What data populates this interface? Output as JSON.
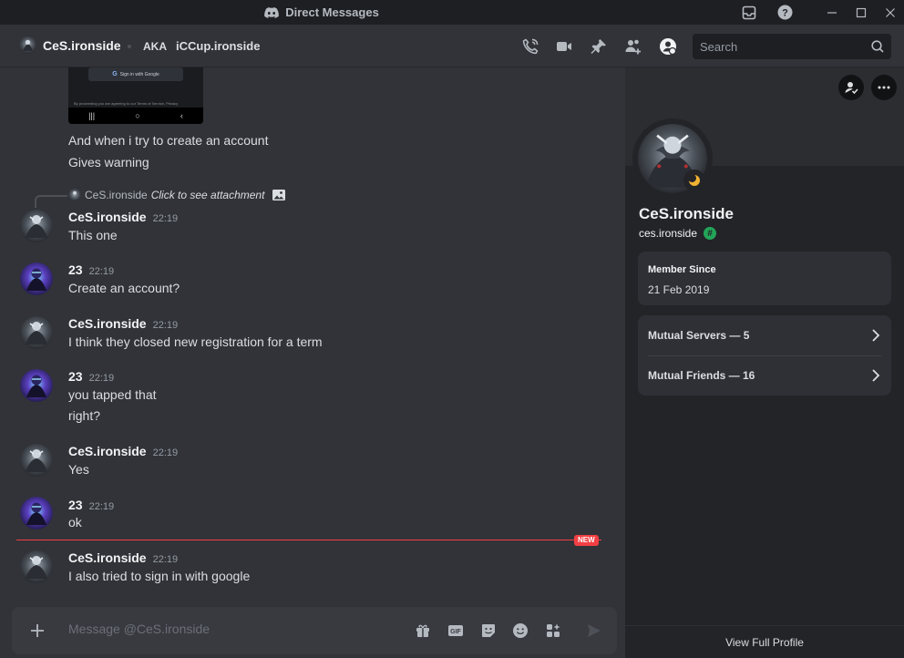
{
  "window": {
    "title": "Direct Messages"
  },
  "header": {
    "username": "CeS.ironside",
    "aka_label": "AKA",
    "aka_name": "iCCup.ironside",
    "search_placeholder": "Search"
  },
  "attachment_preview": {
    "button_text": "Sign in with Google",
    "footer_text": "By proceeding you are agreeing to our Terms of Service, Privacy"
  },
  "earlier_lines": [
    "And when i try to create an account",
    "Gives warning"
  ],
  "reply": {
    "author": "CeS.ironside",
    "text": "Click to see attachment"
  },
  "messages": [
    {
      "author": "CeS.ironside",
      "time": "22:19",
      "lines": [
        "This one"
      ]
    },
    {
      "author": "23",
      "time": "22:19",
      "lines": [
        "Create an account?"
      ]
    },
    {
      "author": "CeS.ironside",
      "time": "22:19",
      "lines": [
        "I think they closed new registration for a term"
      ]
    },
    {
      "author": "23",
      "time": "22:19",
      "lines": [
        "you tapped that",
        "right?"
      ]
    },
    {
      "author": "CeS.ironside",
      "time": "22:19",
      "lines": [
        "Yes"
      ]
    },
    {
      "author": "23",
      "time": "22:19",
      "lines": [
        "ok"
      ]
    },
    {
      "author": "CeS.ironside",
      "time": "22:19",
      "lines": [
        "I also tried to sign in with google"
      ]
    }
  ],
  "new_badge": "NEW",
  "composer": {
    "placeholder": "Message @CeS.ironside"
  },
  "profile": {
    "display_name": "CeS.ironside",
    "handle": "ces.ironside",
    "badge": "#",
    "member_since_label": "Member Since",
    "member_since_value": "21 Feb 2019",
    "mutual_servers": "Mutual Servers — 5",
    "mutual_friends": "Mutual Friends — 16",
    "view_full_profile": "View Full Profile"
  },
  "colors": {
    "background": "#313338",
    "panel": "#232428",
    "accent_red": "#f23f43",
    "online_green": "#23a559",
    "idle_moon": "#f0b232"
  }
}
